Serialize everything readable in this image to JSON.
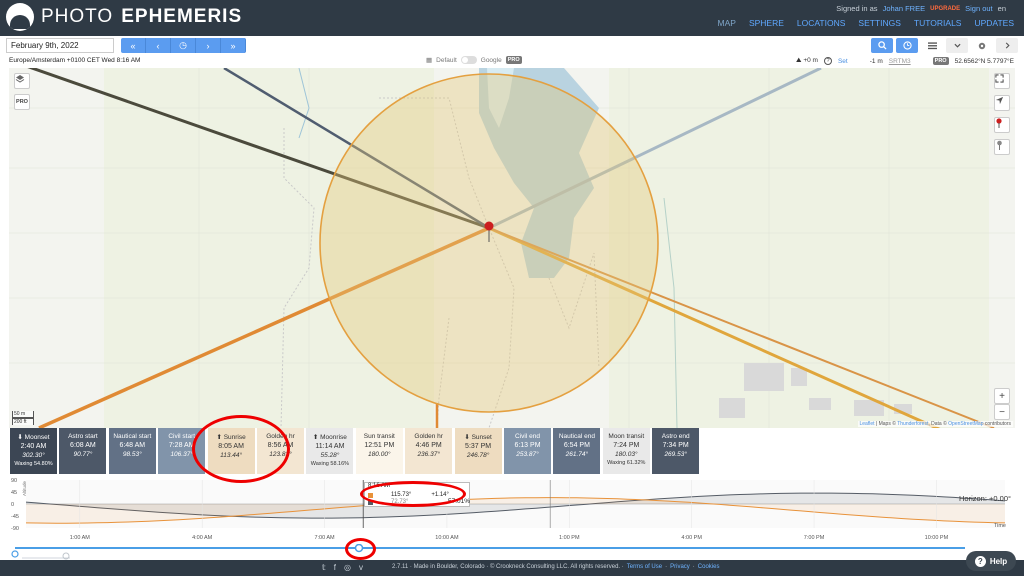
{
  "app": {
    "logo_word1": "PHOTO",
    "logo_word2": "EPHEMERIS",
    "signed_in_prefix": "Signed in as",
    "user": "Johan",
    "plan": "FREE",
    "upgrade": "UPGRADE",
    "sign_out": "Sign out",
    "lang": "en"
  },
  "menu": [
    "MAP",
    "SPHERE",
    "LOCATIONS",
    "SETTINGS",
    "TUTORIALS",
    "UPDATES"
  ],
  "toolbar": {
    "date": "February 9th, 2022",
    "nav": [
      "«",
      "‹",
      "◷",
      "›",
      "»"
    ]
  },
  "info": {
    "timezone": "Europe/Amsterdam +0100 CET Wed 8:16 AM",
    "layer_default": "Default",
    "layer_google": "Google",
    "pro": "PRO",
    "height_offset": "+0 m",
    "help_mark": "?",
    "set": "Set",
    "elevation": "-1 m",
    "srtm": "SRTM3",
    "coords": "52.6562°N 5.7797°E"
  },
  "map": {
    "attribution_leaflet": "Leaflet",
    "attribution_maps": "| Maps ©",
    "attribution_tf": "Thunderforest",
    "attribution_data": ", Data ©",
    "attribution_osm": "OpenStreetMap",
    "attribution_tail": "contributors",
    "scale_m": "50 m",
    "scale_ft": "200 ft",
    "pro": "PRO",
    "zoom_in": "+",
    "zoom_out": "−"
  },
  "events": [
    {
      "label": "⬇ Moonset",
      "time": "2:40 AM",
      "az": "302.30°",
      "pct": "Waxing 54.80%",
      "color": "#3c4654",
      "light": false
    },
    {
      "label": "Astro start",
      "time": "6:08 AM",
      "az": "90.77°",
      "pct": "",
      "color": "#4d5868",
      "light": false
    },
    {
      "label": "Nautical start",
      "time": "6:48 AM",
      "az": "98.53°",
      "pct": "",
      "color": "#627186",
      "light": false
    },
    {
      "label": "Civil start",
      "time": "7:28 AM",
      "az": "106.37°",
      "pct": "",
      "color": "#8194aa",
      "light": false
    },
    {
      "label": "⬆ Sunrise",
      "time": "8:05 AM",
      "az": "113.44°",
      "pct": "",
      "color": "#eedcc0",
      "light": true
    },
    {
      "label": "Golden hr",
      "time": "8:56 AM",
      "az": "123.83°",
      "pct": "",
      "color": "#f3e6d2",
      "light": true
    },
    {
      "label": "⬆ Moonrise",
      "time": "11:14 AM",
      "az": "55.28°",
      "pct": "Waxing 58.16%",
      "color": "#e9e9e9",
      "light": true
    },
    {
      "label": "Sun transit",
      "time": "12:51 PM",
      "az": "180.00°",
      "pct": "",
      "color": "#fbf5ea",
      "light": true
    },
    {
      "label": "Golden hr",
      "time": "4:46 PM",
      "az": "236.37°",
      "pct": "",
      "color": "#f3e6d2",
      "light": true
    },
    {
      "label": "⬇ Sunset",
      "time": "5:37 PM",
      "az": "246.78°",
      "pct": "",
      "color": "#eedcc0",
      "light": true
    },
    {
      "label": "Civil end",
      "time": "6:13 PM",
      "az": "253.87°",
      "pct": "",
      "color": "#8194aa",
      "light": false
    },
    {
      "label": "Nautical end",
      "time": "6:54 PM",
      "az": "261.74°",
      "pct": "",
      "color": "#627186",
      "light": false
    },
    {
      "label": "Moon transit",
      "time": "7:24 PM",
      "az": "180.03°",
      "pct": "Waxing 61.32%",
      "color": "#e9e9e9",
      "light": true
    },
    {
      "label": "Astro end",
      "time": "7:34 PM",
      "az": "269.53°",
      "pct": "",
      "color": "#4d5868",
      "light": false
    }
  ],
  "graph": {
    "y_ticks": [
      "90",
      "45",
      "0",
      "-45",
      "-90"
    ],
    "y_label": "Altitude",
    "x_ticks": [
      "1:00 AM",
      "4:00 AM",
      "7:00 AM",
      "10:00 AM",
      "1:00 PM",
      "4:00 PM",
      "7:00 PM",
      "10:00 PM"
    ],
    "x_label": "Time",
    "horizon": "Horizon: +0.00°",
    "tip_time": "8:16 AM",
    "tip_az": "115.73°",
    "tip_alt": "+1.14°",
    "tip_moon_az": "72.73°",
    "moon_pct": "57.01%",
    "sun_color": "#e8923a",
    "moon_color": "#555c66"
  },
  "footer": {
    "social": [
      "𝕥",
      "f",
      "◎",
      "v"
    ],
    "version": "2.7.11 · Made in Boulder, Colorado · © Crookneck Consulting LLC. All rights reserved. ·",
    "terms": "Terms of Use",
    "privacy": "Privacy",
    "cookies": "Cookies",
    "sep": "·",
    "help": "Help",
    "help_mark": "?"
  }
}
